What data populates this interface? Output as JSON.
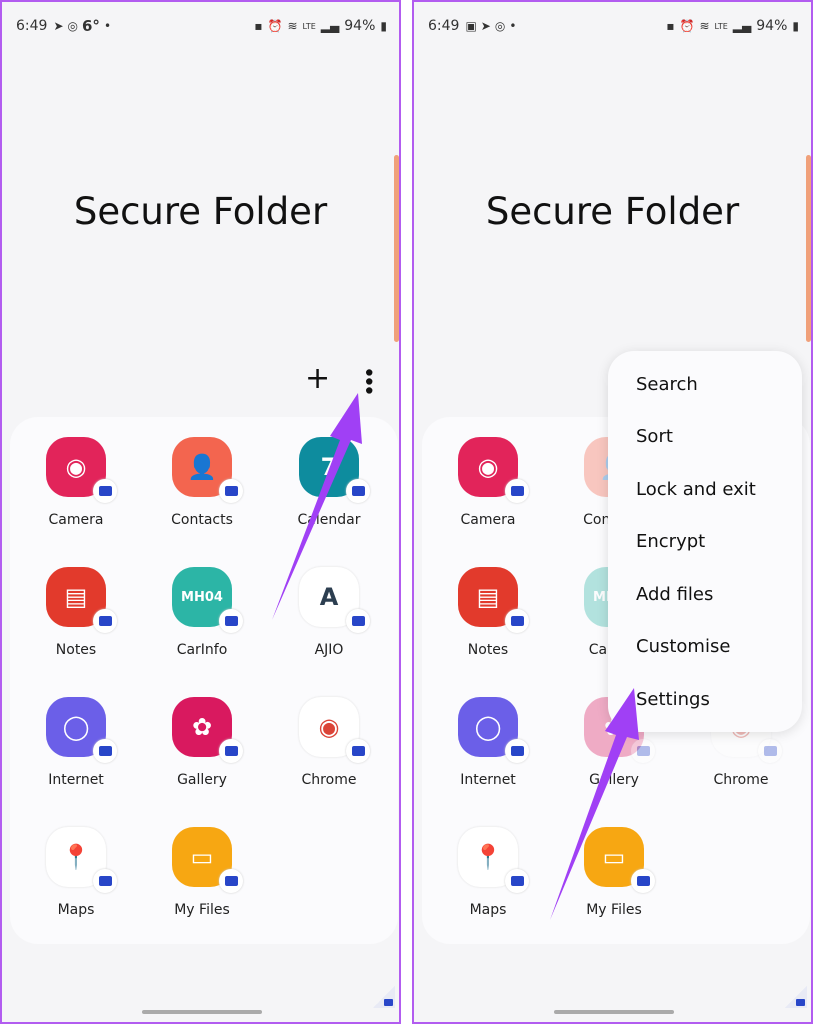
{
  "accent": "#a040f5",
  "panels": [
    {
      "status": {
        "time": "6:49",
        "left_icons": [
          "telegram-icon",
          "instagram-icon",
          "weather-6deg"
        ],
        "weather": "6°",
        "battery": "94%"
      },
      "title": "Secure Folder",
      "add_label": "+",
      "more_label": "⋮",
      "menu_open": false
    },
    {
      "status": {
        "time": "6:49",
        "left_icons": [
          "gallery-icon",
          "telegram-icon",
          "instagram-icon"
        ],
        "battery": "94%"
      },
      "title": "Secure Folder",
      "add_label": "+",
      "more_label": "⋮",
      "menu_open": true,
      "menu": [
        "Search",
        "Sort",
        "Lock and exit",
        "Encrypt",
        "Add files",
        "Customise",
        "Settings"
      ]
    }
  ],
  "apps": [
    {
      "name": "Camera",
      "color": "#e2245a",
      "glyph": "◉"
    },
    {
      "name": "Contacts",
      "color": "#f3654f",
      "glyph": "👤"
    },
    {
      "name": "Calendar",
      "color": "#0e8c9e",
      "glyph": "7"
    },
    {
      "name": "Notes",
      "color": "#e23a2c",
      "glyph": "▤"
    },
    {
      "name": "CarInfo",
      "color": "#2cb5a6",
      "glyph": "MH04"
    },
    {
      "name": "AJIO",
      "color": "#ffffff",
      "glyph": "A",
      "fg": "#2c3e50"
    },
    {
      "name": "Internet",
      "color": "#6b5fe8",
      "glyph": "◯"
    },
    {
      "name": "Gallery",
      "color": "#d9195f",
      "glyph": "✿"
    },
    {
      "name": "Chrome",
      "color": "#ffffff",
      "glyph": "◉",
      "fg": "#db4437"
    },
    {
      "name": "Maps",
      "color": "#ffffff",
      "glyph": "📍",
      "fg": "#34a853"
    },
    {
      "name": "My Files",
      "color": "#f7a712",
      "glyph": "▭"
    }
  ]
}
